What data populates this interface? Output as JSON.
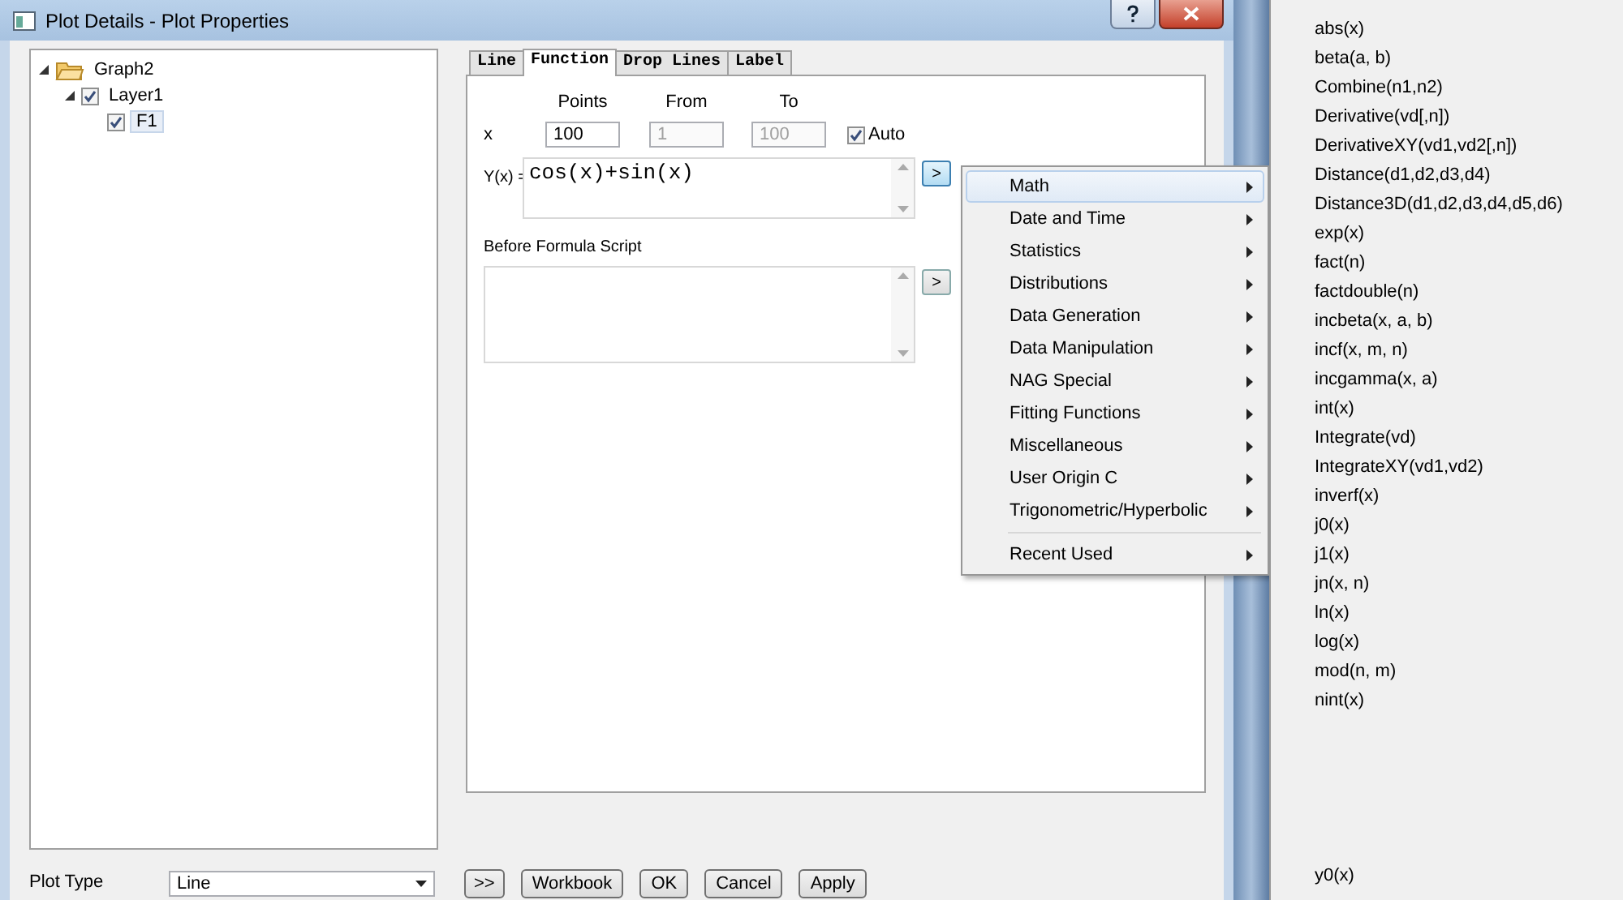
{
  "window": {
    "title": "Plot Details - Plot Properties"
  },
  "tree": [
    {
      "label": "Graph2",
      "expanded": true,
      "children": [
        {
          "label": "Layer1",
          "checked": true,
          "expanded": true,
          "children": [
            {
              "label": "F1",
              "checked": true,
              "selected": true
            }
          ]
        }
      ]
    }
  ],
  "tabs": [
    {
      "label": "Line",
      "selected": false
    },
    {
      "label": "Function",
      "selected": true
    },
    {
      "label": "Drop Lines",
      "selected": false
    },
    {
      "label": "Label",
      "selected": false
    }
  ],
  "function": {
    "x_label": "x",
    "fields": [
      {
        "label": "Points",
        "value": "100",
        "disabled": false
      },
      {
        "label": "From",
        "value": "1",
        "disabled": true
      },
      {
        "label": "To",
        "value": "100",
        "disabled": true
      }
    ],
    "auto": {
      "label": "Auto",
      "checked": true
    },
    "y_label": "Y(x) =",
    "formula": "cos(x)+sin(x)",
    "formula_button": ">",
    "script_label": "Before Formula Script",
    "script_button": ">"
  },
  "plot_type": {
    "label": "Plot Type",
    "value": "Line"
  },
  "buttons": [
    ">>",
    "Workbook",
    "OK",
    "Cancel",
    "Apply"
  ],
  "menu": {
    "groups": [
      [
        {
          "label": "Math",
          "selected": true
        },
        {
          "label": "Date and Time",
          "selected": false
        },
        {
          "label": "Statistics",
          "selected": false
        },
        {
          "label": "Distributions",
          "selected": false
        },
        {
          "label": "Data Generation",
          "selected": false
        },
        {
          "label": "Data Manipulation",
          "selected": false
        },
        {
          "label": "NAG Special",
          "selected": false
        },
        {
          "label": "Fitting Functions",
          "selected": false
        },
        {
          "label": "Miscellaneous",
          "selected": false
        },
        {
          "label": "User Origin C",
          "selected": false
        },
        {
          "label": "Trigonometric/Hyperbolic",
          "selected": false
        }
      ],
      [
        {
          "label": "Recent Used",
          "selected": false
        }
      ]
    ]
  },
  "submenu": {
    "items": [
      "abs(x)",
      "beta(a, b)",
      "Combine(n1,n2)",
      "Derivative(vd[,n])",
      "DerivativeXY(vd1,vd2[,n])",
      "Distance(d1,d2,d3,d4)",
      "Distance3D(d1,d2,d3,d4,d5,d6)",
      "exp(x)",
      "fact(n)",
      "factdouble(n)",
      "incbeta(x, a, b)",
      "incf(x, m, n)",
      "incgamma(x, a)",
      "int(x)",
      "Integrate(vd)",
      "IntegrateXY(vd1,vd2)",
      "inverf(x)",
      "j0(x)",
      "j1(x)",
      "jn(x, n)",
      "ln(x)",
      "log(x)",
      "mod(n, m)",
      "nint(x)"
    ],
    "items_after_gap": [
      "y0(x)"
    ]
  }
}
